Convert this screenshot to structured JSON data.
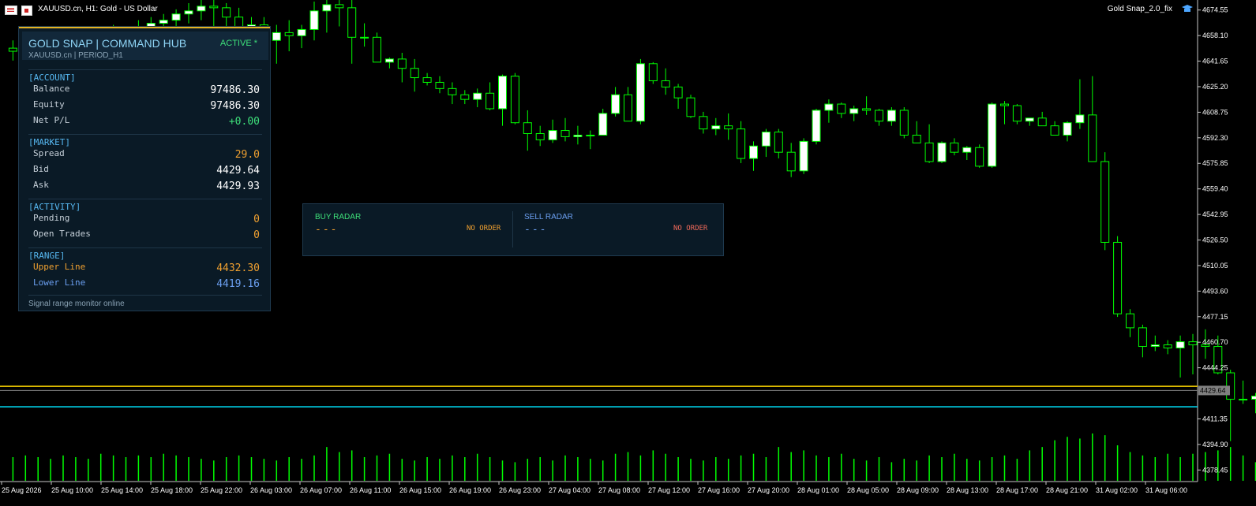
{
  "window": {
    "title": "XAUUSD.cn, H1:  Gold - US Dollar",
    "ea_name": "Gold Snap_2.0_fix"
  },
  "price_axis": {
    "labels": [
      "4674.55",
      "4658.10",
      "4641.65",
      "4625.20",
      "4608.75",
      "4592.30",
      "4575.85",
      "4559.40",
      "4542.95",
      "4526.50",
      "4510.05",
      "4493.60",
      "4477.15",
      "4460.70",
      "4444.25",
      "4411.35",
      "4394.90",
      "4378.45"
    ],
    "current_price_label": "4429.64"
  },
  "time_axis": {
    "labels": [
      "25 Aug 2026",
      "25 Aug 10:00",
      "25 Aug 14:00",
      "25 Aug 18:00",
      "25 Aug 22:00",
      "26 Aug 03:00",
      "26 Aug 07:00",
      "26 Aug 11:00",
      "26 Aug 15:00",
      "26 Aug 19:00",
      "26 Aug 23:00",
      "27 Aug 04:00",
      "27 Aug 08:00",
      "27 Aug 12:00",
      "27 Aug 16:00",
      "27 Aug 20:00",
      "28 Aug 01:00",
      "28 Aug 05:00",
      "28 Aug 09:00",
      "28 Aug 13:00",
      "28 Aug 17:00",
      "28 Aug 21:00",
      "31 Aug 02:00",
      "31 Aug 06:00"
    ]
  },
  "hub": {
    "title": "GOLD SNAP | COMMAND HUB",
    "subtitle": "XAUUSD.cn | PERIOD_H1",
    "status": "ACTIVE  *",
    "account_header": "[ACCOUNT]",
    "balance_label": "Balance",
    "balance_value": "97486.30",
    "equity_label": "Equity",
    "equity_value": "97486.30",
    "netpl_label": "Net P/L",
    "netpl_value": "+0.00",
    "market_header": "[MARKET]",
    "spread_label": "Spread",
    "spread_value": "29.0",
    "bid_label": "Bid",
    "bid_value": "4429.64",
    "ask_label": "Ask",
    "ask_value": "4429.93",
    "activity_header": "[ACTIVITY]",
    "pending_label": "Pending",
    "pending_value": "0",
    "open_trades_label": "Open Trades",
    "open_trades_value": "0",
    "range_header": "[RANGE]",
    "upper_label": "Upper Line",
    "upper_value": "4432.30",
    "lower_label": "Lower Line",
    "lower_value": "4419.16",
    "footer": "Signal range monitor online"
  },
  "radar": {
    "buy_title": "BUY RADAR",
    "buy_dash": "---",
    "buy_state": "NO ORDER",
    "sell_title": "SELL RADAR",
    "sell_dash": "---",
    "sell_state": "NO ORDER"
  },
  "colors": {
    "bull_body": "#ffffff",
    "bear_body": "#000000",
    "wick": "#00ff00",
    "volume": "#00ff00",
    "upper_line": "#ffd700",
    "lower_line": "#00e5ff",
    "bid_line": "#808080",
    "accent_orange": "#f0a030",
    "accent_blue": "#6b9ff0",
    "buy_green": "#3ee07a"
  },
  "chart_data": {
    "type": "candlestick",
    "symbol": "XAUUSD.cn",
    "timeframe": "H1",
    "ylim": [
      4371,
      4681
    ],
    "horizontal_lines": [
      {
        "name": "Upper Line",
        "value": 4432.3
      },
      {
        "name": "Bid",
        "value": 4429.64
      },
      {
        "name": "Lower Line",
        "value": 4419.16
      }
    ],
    "candles": [
      {
        "o": 4650,
        "h": 4655,
        "l": 4642,
        "c": 4648
      },
      {
        "o": 4648,
        "h": 4652,
        "l": 4640,
        "c": 4645
      },
      {
        "o": 4645,
        "h": 4652,
        "l": 4638,
        "c": 4647
      },
      {
        "o": 4647,
        "h": 4655,
        "l": 4642,
        "c": 4650
      },
      {
        "o": 4650,
        "h": 4658,
        "l": 4644,
        "c": 4655
      },
      {
        "o": 4655,
        "h": 4660,
        "l": 4648,
        "c": 4652
      },
      {
        "o": 4652,
        "h": 4658,
        "l": 4645,
        "c": 4656
      },
      {
        "o": 4656,
        "h": 4663,
        "l": 4650,
        "c": 4660
      },
      {
        "o": 4660,
        "h": 4665,
        "l": 4653,
        "c": 4657
      },
      {
        "o": 4657,
        "h": 4664,
        "l": 4650,
        "c": 4662
      },
      {
        "o": 4662,
        "h": 4668,
        "l": 4655,
        "c": 4664
      },
      {
        "o": 4664,
        "h": 4670,
        "l": 4658,
        "c": 4666
      },
      {
        "o": 4666,
        "h": 4672,
        "l": 4660,
        "c": 4668
      },
      {
        "o": 4668,
        "h": 4675,
        "l": 4662,
        "c": 4672
      },
      {
        "o": 4672,
        "h": 4679,
        "l": 4666,
        "c": 4674
      },
      {
        "o": 4674,
        "h": 4681,
        "l": 4668,
        "c": 4677
      },
      {
        "o": 4677,
        "h": 4681,
        "l": 4660,
        "c": 4676
      },
      {
        "o": 4676,
        "h": 4679,
        "l": 4662,
        "c": 4670
      },
      {
        "o": 4670,
        "h": 4676,
        "l": 4655,
        "c": 4660
      },
      {
        "o": 4660,
        "h": 4670,
        "l": 4650,
        "c": 4665
      },
      {
        "o": 4665,
        "h": 4670,
        "l": 4652,
        "c": 4655
      },
      {
        "o": 4655,
        "h": 4665,
        "l": 4640,
        "c": 4660
      },
      {
        "o": 4660,
        "h": 4668,
        "l": 4648,
        "c": 4658
      },
      {
        "o": 4658,
        "h": 4665,
        "l": 4650,
        "c": 4662
      },
      {
        "o": 4662,
        "h": 4680,
        "l": 4655,
        "c": 4674
      },
      {
        "o": 4674,
        "h": 4681,
        "l": 4660,
        "c": 4678
      },
      {
        "o": 4678,
        "h": 4681,
        "l": 4664,
        "c": 4676
      },
      {
        "o": 4676,
        "h": 4681,
        "l": 4640,
        "c": 4657
      },
      {
        "o": 4657,
        "h": 4666,
        "l": 4651,
        "c": 4657
      },
      {
        "o": 4657,
        "h": 4660,
        "l": 4650,
        "c": 4641
      },
      {
        "o": 4641,
        "h": 4644,
        "l": 4637,
        "c": 4643
      },
      {
        "o": 4643,
        "h": 4647,
        "l": 4628,
        "c": 4637
      },
      {
        "o": 4637,
        "h": 4643,
        "l": 4622,
        "c": 4631
      },
      {
        "o": 4631,
        "h": 4634,
        "l": 4626,
        "c": 4628
      },
      {
        "o": 4628,
        "h": 4632,
        "l": 4621,
        "c": 4624
      },
      {
        "o": 4624,
        "h": 4628,
        "l": 4614,
        "c": 4620
      },
      {
        "o": 4620,
        "h": 4623,
        "l": 4614,
        "c": 4617
      },
      {
        "o": 4617,
        "h": 4624,
        "l": 4612,
        "c": 4621
      },
      {
        "o": 4621,
        "h": 4628,
        "l": 4610,
        "c": 4611
      },
      {
        "o": 4611,
        "h": 4633,
        "l": 4600,
        "c": 4632
      },
      {
        "o": 4632,
        "h": 4634,
        "l": 4601,
        "c": 4602
      },
      {
        "o": 4602,
        "h": 4610,
        "l": 4584,
        "c": 4595
      },
      {
        "o": 4595,
        "h": 4600,
        "l": 4587,
        "c": 4591
      },
      {
        "o": 4591,
        "h": 4604,
        "l": 4589,
        "c": 4597
      },
      {
        "o": 4597,
        "h": 4605,
        "l": 4590,
        "c": 4593
      },
      {
        "o": 4593,
        "h": 4600,
        "l": 4588,
        "c": 4594
      },
      {
        "o": 4594,
        "h": 4597,
        "l": 4585,
        "c": 4594
      },
      {
        "o": 4594,
        "h": 4611,
        "l": 4594,
        "c": 4608
      },
      {
        "o": 4608,
        "h": 4625,
        "l": 4606,
        "c": 4620
      },
      {
        "o": 4620,
        "h": 4625,
        "l": 4603,
        "c": 4603
      },
      {
        "o": 4603,
        "h": 4643,
        "l": 4601,
        "c": 4640
      },
      {
        "o": 4640,
        "h": 4641,
        "l": 4627,
        "c": 4629
      },
      {
        "o": 4629,
        "h": 4637,
        "l": 4620,
        "c": 4625
      },
      {
        "o": 4625,
        "h": 4627,
        "l": 4611,
        "c": 4618
      },
      {
        "o": 4618,
        "h": 4620,
        "l": 4605,
        "c": 4606
      },
      {
        "o": 4606,
        "h": 4609,
        "l": 4595,
        "c": 4598
      },
      {
        "o": 4598,
        "h": 4605,
        "l": 4594,
        "c": 4600
      },
      {
        "o": 4600,
        "h": 4608,
        "l": 4591,
        "c": 4598
      },
      {
        "o": 4598,
        "h": 4603,
        "l": 4576,
        "c": 4579
      },
      {
        "o": 4579,
        "h": 4590,
        "l": 4571,
        "c": 4587
      },
      {
        "o": 4587,
        "h": 4598,
        "l": 4580,
        "c": 4596
      },
      {
        "o": 4596,
        "h": 4598,
        "l": 4579,
        "c": 4583
      },
      {
        "o": 4583,
        "h": 4589,
        "l": 4567,
        "c": 4571
      },
      {
        "o": 4571,
        "h": 4592,
        "l": 4569,
        "c": 4590
      },
      {
        "o": 4590,
        "h": 4611,
        "l": 4588,
        "c": 4610
      },
      {
        "o": 4610,
        "h": 4617,
        "l": 4602,
        "c": 4614
      },
      {
        "o": 4614,
        "h": 4615,
        "l": 4605,
        "c": 4608
      },
      {
        "o": 4608,
        "h": 4613,
        "l": 4603,
        "c": 4611
      },
      {
        "o": 4611,
        "h": 4619,
        "l": 4607,
        "c": 4610
      },
      {
        "o": 4610,
        "h": 4611,
        "l": 4600,
        "c": 4603
      },
      {
        "o": 4603,
        "h": 4612,
        "l": 4600,
        "c": 4610
      },
      {
        "o": 4610,
        "h": 4612,
        "l": 4592,
        "c": 4594
      },
      {
        "o": 4594,
        "h": 4603,
        "l": 4590,
        "c": 4589
      },
      {
        "o": 4589,
        "h": 4601,
        "l": 4576,
        "c": 4577
      },
      {
        "o": 4577,
        "h": 4590,
        "l": 4576,
        "c": 4589
      },
      {
        "o": 4589,
        "h": 4592,
        "l": 4581,
        "c": 4583
      },
      {
        "o": 4583,
        "h": 4587,
        "l": 4578,
        "c": 4586
      },
      {
        "o": 4586,
        "h": 4588,
        "l": 4573,
        "c": 4574
      },
      {
        "o": 4574,
        "h": 4615,
        "l": 4573,
        "c": 4614
      },
      {
        "o": 4614,
        "h": 4616,
        "l": 4601,
        "c": 4613
      },
      {
        "o": 4613,
        "h": 4614,
        "l": 4601,
        "c": 4603
      },
      {
        "o": 4603,
        "h": 4605,
        "l": 4600,
        "c": 4605
      },
      {
        "o": 4605,
        "h": 4609,
        "l": 4600,
        "c": 4600
      },
      {
        "o": 4600,
        "h": 4603,
        "l": 4594,
        "c": 4594
      },
      {
        "o": 4594,
        "h": 4603,
        "l": 4590,
        "c": 4602
      },
      {
        "o": 4602,
        "h": 4630,
        "l": 4598,
        "c": 4607
      },
      {
        "o": 4607,
        "h": 4632,
        "l": 4577,
        "c": 4577
      },
      {
        "o": 4577,
        "h": 4583,
        "l": 4520,
        "c": 4525
      },
      {
        "o": 4525,
        "h": 4529,
        "l": 4477,
        "c": 4479
      },
      {
        "o": 4479,
        "h": 4482,
        "l": 4464,
        "c": 4470
      },
      {
        "o": 4470,
        "h": 4472,
        "l": 4451,
        "c": 4458
      },
      {
        "o": 4458,
        "h": 4465,
        "l": 4455,
        "c": 4459
      },
      {
        "o": 4459,
        "h": 4462,
        "l": 4453,
        "c": 4457
      },
      {
        "o": 4457,
        "h": 4465,
        "l": 4438,
        "c": 4461
      },
      {
        "o": 4461,
        "h": 4466,
        "l": 4440,
        "c": 4459
      },
      {
        "o": 4459,
        "h": 4469,
        "l": 4450,
        "c": 4458
      },
      {
        "o": 4458,
        "h": 4465,
        "l": 4440,
        "c": 4441
      },
      {
        "o": 4441,
        "h": 4443,
        "l": 4397,
        "c": 4424
      },
      {
        "o": 4424,
        "h": 4436,
        "l": 4421,
        "c": 4424
      },
      {
        "o": 4424,
        "h": 4428,
        "l": 4415,
        "c": 4426
      },
      {
        "o": 4426,
        "h": 4433,
        "l": 4420,
        "c": 4430
      }
    ],
    "volume": [
      14,
      15,
      14,
      13,
      15,
      14,
      13,
      16,
      15,
      14,
      15,
      14,
      16,
      15,
      14,
      13,
      12,
      14,
      15,
      14,
      13,
      12,
      14,
      13,
      15,
      20,
      17,
      18,
      14,
      15,
      16,
      13,
      12,
      14,
      13,
      15,
      14,
      16,
      14,
      12,
      11,
      13,
      14,
      12,
      15,
      14,
      13,
      12,
      16,
      17,
      15,
      18,
      16,
      14,
      13,
      12,
      14,
      13,
      15,
      16,
      14,
      20,
      17,
      18,
      15,
      14,
      16,
      13,
      12,
      14,
      11,
      13,
      12,
      15,
      14,
      16,
      13,
      12,
      14,
      15,
      13,
      18,
      20,
      24,
      26,
      25,
      28,
      27,
      21,
      17,
      15,
      14,
      16,
      14,
      16,
      17,
      18,
      20,
      15,
      11,
      7,
      5
    ]
  }
}
